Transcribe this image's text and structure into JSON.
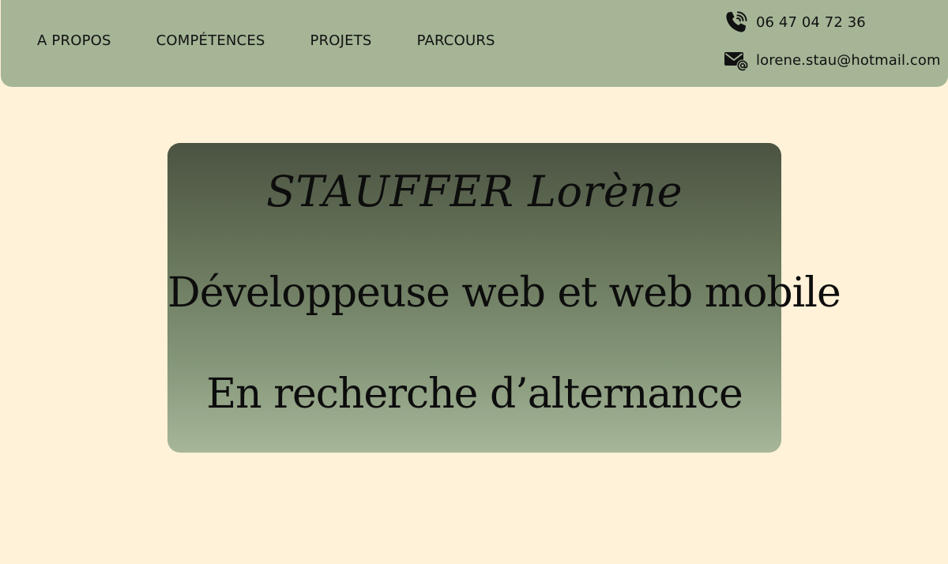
{
  "nav": {
    "items": [
      {
        "label": "A PROPOS"
      },
      {
        "label": "COMPÉTENCES"
      },
      {
        "label": "PROJETS"
      },
      {
        "label": "PARCOURS"
      }
    ]
  },
  "contact": {
    "phone": {
      "icon": "phone-icon",
      "text": "06 47 04 72 36"
    },
    "email": {
      "icon": "email-icon",
      "text": "lorene.stau@hotmail.com"
    }
  },
  "hero": {
    "name": "STAUFFER Lorène",
    "role": "Développeuse web et web mobile",
    "status": "En recherche d’alternance"
  },
  "colors": {
    "background": "#fff2d8",
    "header": "#a5b596",
    "hero_gradient_top": "#4b5342",
    "hero_gradient_bottom": "#a7b699",
    "text": "#111111"
  }
}
